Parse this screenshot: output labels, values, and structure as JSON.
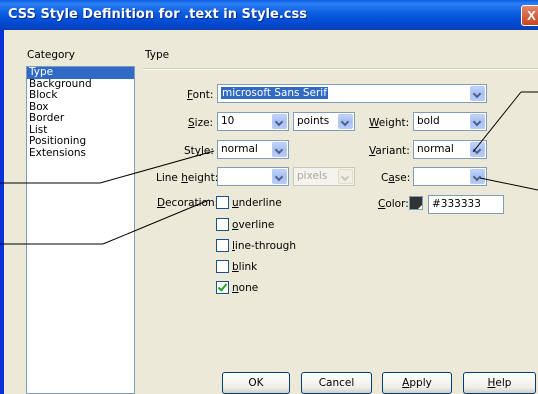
{
  "dialog": {
    "title": "CSS Style Definition for .text in Style.css",
    "close_glyph": "X"
  },
  "category": {
    "heading": "Category",
    "items": [
      "Type",
      "Background",
      "Block",
      "Box",
      "Border",
      "List",
      "Positioning",
      "Extensions"
    ],
    "selected": "Type"
  },
  "panel": {
    "heading": "Type"
  },
  "font": {
    "label": "Font:",
    "value": "microsoft Sans Serif"
  },
  "size": {
    "label": "Size:",
    "value": "10",
    "unit": "points"
  },
  "weight": {
    "label": "Weight:",
    "value": "bold"
  },
  "style": {
    "label": "Style:",
    "value": "normal"
  },
  "variant": {
    "label": "Variant:",
    "value": "normal"
  },
  "line_height": {
    "label": "Line height:",
    "value": "",
    "unit": "pixels"
  },
  "case": {
    "label": "Case:",
    "value": ""
  },
  "decoration": {
    "label": "Decoration:",
    "options": [
      {
        "label": "underline",
        "checked": false
      },
      {
        "label": "overline",
        "checked": false
      },
      {
        "label": "line-through",
        "checked": false
      },
      {
        "label": "blink",
        "checked": false
      },
      {
        "label": "none",
        "checked": true
      }
    ]
  },
  "color": {
    "label": "Color:",
    "value": "#333333",
    "swatch": "#333333"
  },
  "buttons": {
    "ok": "OK",
    "cancel": "Cancel",
    "apply": "Apply",
    "help": "Help"
  }
}
